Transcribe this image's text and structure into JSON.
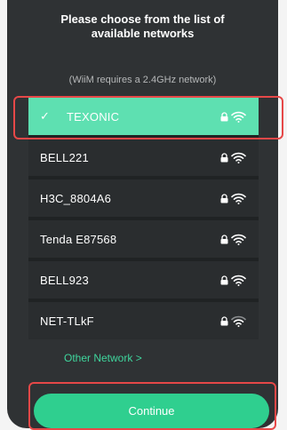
{
  "header": {
    "title_line1": "Please choose from the list of",
    "title_line2": "available networks"
  },
  "subtitle": "(WiiM requires a 2.4GHz network)",
  "networks": [
    {
      "ssid": "TEXONIC",
      "selected": true,
      "secured": true,
      "signal": "full"
    },
    {
      "ssid": "BELL221",
      "selected": false,
      "secured": true,
      "signal": "full"
    },
    {
      "ssid": "H3C_8804A6",
      "selected": false,
      "secured": true,
      "signal": "full"
    },
    {
      "ssid": "Tenda E87568",
      "selected": false,
      "secured": true,
      "signal": "full"
    },
    {
      "ssid": "BELL923",
      "selected": false,
      "secured": true,
      "signal": "full"
    },
    {
      "ssid": "NET-TLkF",
      "selected": false,
      "secured": true,
      "signal": "weak"
    }
  ],
  "other_network": "Other Network >",
  "continue_label": "Continue",
  "colors": {
    "background": "#2f3234",
    "accent": "#2fcf8f",
    "selected_row": "#5ee0b1",
    "highlight": "#e64848"
  }
}
